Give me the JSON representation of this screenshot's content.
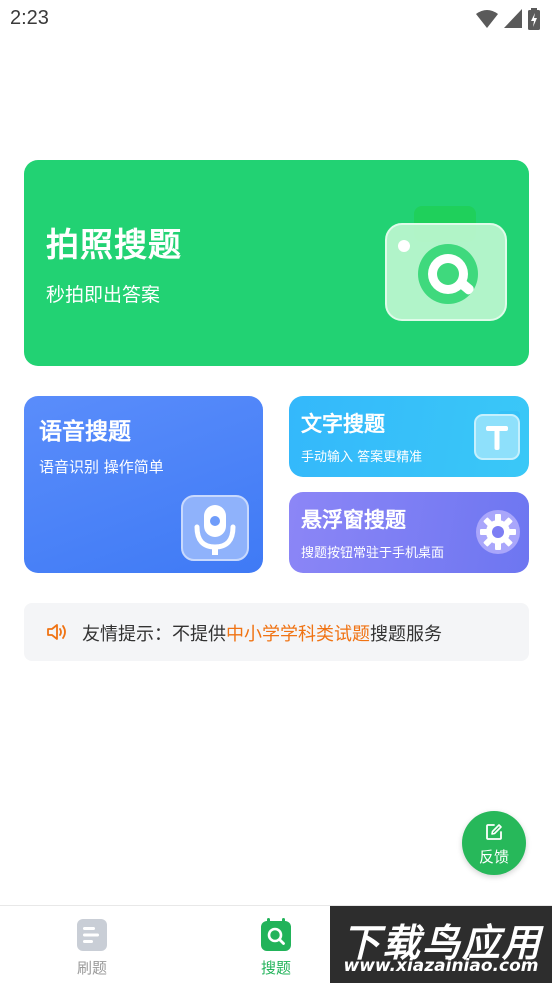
{
  "status_bar": {
    "time": "2:23"
  },
  "cards": {
    "photo": {
      "title": "拍照搜题",
      "subtitle": "秒拍即出答案"
    },
    "voice": {
      "title": "语音搜题",
      "subtitle": "语音识别 操作简单"
    },
    "text": {
      "title": "文字搜题",
      "subtitle": "手动输入 答案更精准"
    },
    "float": {
      "title": "悬浮窗搜题",
      "subtitle": "搜题按钮常驻于手机桌面"
    }
  },
  "tip": {
    "prefix": "友情提示：不提供",
    "highlight": "中小学学科类试题",
    "suffix": "搜题服务",
    "highlight_color": "#f07313"
  },
  "fab": {
    "label": "反馈"
  },
  "bottom_nav": {
    "items": [
      {
        "label": "刷题",
        "icon": "document-icon"
      },
      {
        "label": "搜题",
        "icon": "search-icon"
      }
    ],
    "active_color": "#22b35a"
  },
  "watermark": {
    "title": "下载鸟应用",
    "url": "www.xiazainiao.com"
  },
  "colors": {
    "photo_card": "#22d273",
    "voice_card": "#4a82f8",
    "text_card": "#36bff9",
    "float_card": "#7d7ef4",
    "fab": "#27b85a"
  }
}
